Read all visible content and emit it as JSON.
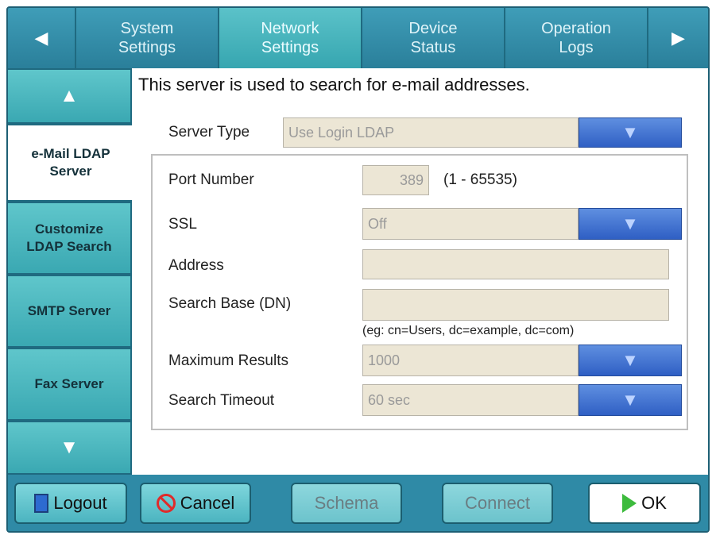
{
  "tabs": {
    "prev_arrow": "◀",
    "next_arrow": "▶",
    "items": [
      {
        "line1": "System",
        "line2": "Settings"
      },
      {
        "line1": "Network",
        "line2": "Settings"
      },
      {
        "line1": "Device",
        "line2": "Status"
      },
      {
        "line1": "Operation",
        "line2": "Logs"
      }
    ],
    "active": "Network Settings"
  },
  "sidebar": {
    "up_arrow": "▲",
    "down_arrow": "▼",
    "items": [
      {
        "line1": "e-Mail LDAP",
        "line2": "Server"
      },
      {
        "line1": "Customize",
        "line2": "LDAP Search"
      },
      {
        "line1": "SMTP Server",
        "line2": ""
      },
      {
        "line1": "Fax Server",
        "line2": ""
      }
    ],
    "selected": "e-Mail LDAP Server"
  },
  "content": {
    "description": "This server is used to search for e-mail addresses.",
    "server_type": {
      "label": "Server Type",
      "value": "Use Login LDAP"
    },
    "port": {
      "label": "Port Number",
      "value": "389",
      "range": "(1 - 65535)"
    },
    "ssl": {
      "label": "SSL",
      "value": "Off"
    },
    "address": {
      "label": "Address",
      "value": ""
    },
    "search_base": {
      "label": "Search Base (DN)",
      "value": "",
      "hint": "(eg: cn=Users, dc=example, dc=com)"
    },
    "max_results": {
      "label": "Maximum Results",
      "value": "1000"
    },
    "timeout": {
      "label": "Search Timeout",
      "value": "60 sec"
    },
    "dropdown_arrow": "▼"
  },
  "buttons": {
    "logout": "Logout",
    "cancel": "Cancel",
    "schema": "Schema",
    "connect": "Connect",
    "ok": "OK"
  }
}
